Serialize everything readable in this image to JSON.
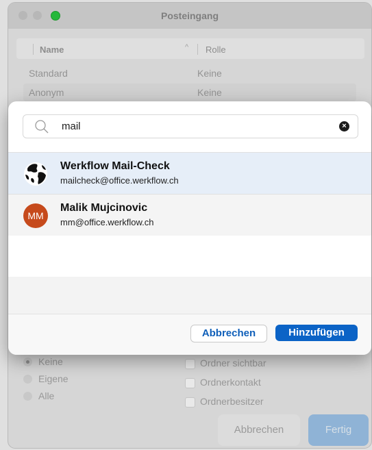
{
  "window": {
    "title": "Posteingang",
    "columns": {
      "name": "Name",
      "role": "Rolle"
    },
    "rows": [
      {
        "name": "Standard",
        "role": "Keine"
      },
      {
        "name": "Anonym",
        "role": "Keine"
      }
    ],
    "permission_radios": [
      {
        "label": "Keine",
        "selected": true
      },
      {
        "label": "Eigene",
        "selected": false
      },
      {
        "label": "Alle",
        "selected": false
      }
    ],
    "permission_checks": [
      {
        "label": "Ordner sichtbar",
        "checked": false
      },
      {
        "label": "Ordnerkontakt",
        "checked": false
      },
      {
        "label": "Ordnerbesitzer",
        "checked": false
      }
    ],
    "cancel_label": "Abbrechen",
    "done_label": "Fertig"
  },
  "sheet": {
    "search": {
      "value": "mail",
      "icon": "magnifier-icon",
      "clear_icon": "clear-icon"
    },
    "results": [
      {
        "name": "Werkflow Mail-Check",
        "email": "mailcheck@office.werkflow.ch",
        "avatar": "globe-icon",
        "selected": true
      },
      {
        "name": "Malik Mujcinovic",
        "email": "mm@office.werkflow.ch",
        "avatar_initials": "MM",
        "avatar_color": "#c64a1c",
        "selected": false
      }
    ],
    "cancel_label": "Abbrechen",
    "add_label": "Hinzufügen"
  },
  "colors": {
    "accent": "#0b63c6",
    "selection": "#e6eef8"
  }
}
